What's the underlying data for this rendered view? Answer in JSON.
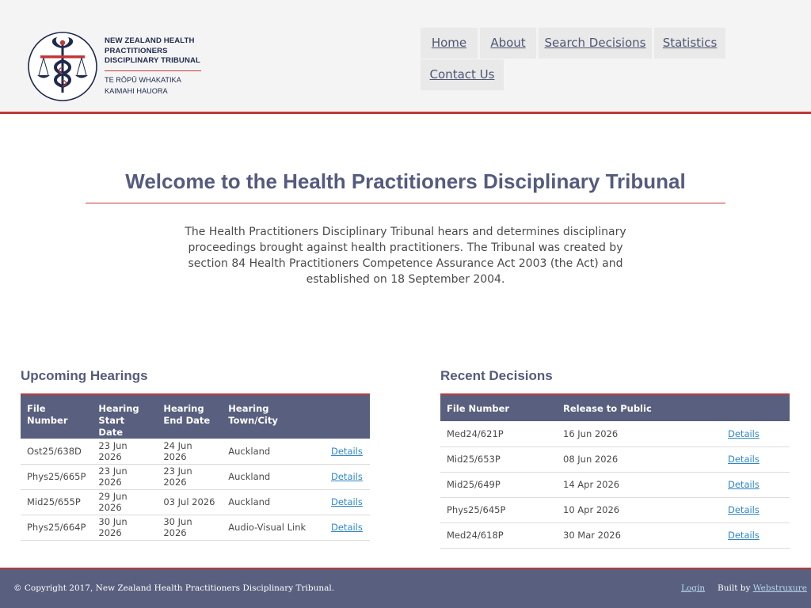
{
  "header": {
    "logo": {
      "name_en": [
        "NEW ZEALAND HEALTH",
        "PRACTITIONERS",
        "DISCIPLINARY TRIBUNAL"
      ],
      "name_mi": [
        "TE RŌPŪ WHAKATIKA",
        "KAIMAHI HAUORA"
      ],
      "icon": "caduceus-scales-seal",
      "colors": {
        "navy": "#1e2a4d",
        "red": "#c0383a"
      }
    },
    "nav": {
      "home": "Home",
      "about": "About",
      "search": "Search Decisions",
      "statistics": "Statistics",
      "contact": "Contact Us"
    }
  },
  "intro": {
    "title": "Welcome to the Health Practitioners Disciplinary Tribunal",
    "body": "The Health Practitioners Disciplinary Tribunal hears and determines disciplinary proceedings brought against health practitioners. The Tribunal was created by section 84 Health Practitioners Competence Assurance Act 2003 (the Act) and established on 18 September 2004."
  },
  "upcoming": {
    "title": "Upcoming Hearings",
    "columns": {
      "file_number": "File Number",
      "start_date": [
        "Hearing",
        "Start Date"
      ],
      "end_date": [
        "Hearing",
        "End Date"
      ],
      "town": "Hearing Town/City"
    },
    "rows": [
      {
        "file": "Ost25/638D",
        "start": "23 Jun 2026",
        "end": "24 Jun 2026",
        "town": "Auckland",
        "link": "Details"
      },
      {
        "file": "Phys25/665P",
        "start": "23 Jun 2026",
        "end": "23 Jun 2026",
        "town": "Auckland",
        "link": "Details"
      },
      {
        "file": "Mid25/655P",
        "start": "29 Jun 2026",
        "end": "03 Jul 2026",
        "town": "Auckland",
        "link": "Details"
      },
      {
        "file": "Phys25/664P",
        "start": "30 Jun 2026",
        "end": "30 Jun 2026",
        "town": "Audio-Visual Link",
        "link": "Details"
      }
    ]
  },
  "recent": {
    "title": "Recent Decisions",
    "columns": {
      "file_number": "File Number",
      "release": "Release to Public"
    },
    "rows": [
      {
        "file": "Med24/621P",
        "release": "16 Jun 2026",
        "link": "Details"
      },
      {
        "file": "Mid25/653P",
        "release": "08 Jun 2026",
        "link": "Details"
      },
      {
        "file": "Mid25/649P",
        "release": "14 Apr 2026",
        "link": "Details"
      },
      {
        "file": "Phys25/645P",
        "release": "10 Apr 2026",
        "link": "Details"
      },
      {
        "file": "Med24/618P",
        "release": "30 Mar 2026",
        "link": "Details"
      }
    ]
  },
  "footer": {
    "copyright": "© Copyright 2017, New Zealand Health Practitioners Disciplinary Tribunal.",
    "login": "Login",
    "built_by": "Built by",
    "builder": "Webstruxure"
  },
  "colors": {
    "accent_red": "#c0383a",
    "header_slate": "#595f7e",
    "title_slate": "#555b7e",
    "link_blue": "#2f87c7"
  }
}
